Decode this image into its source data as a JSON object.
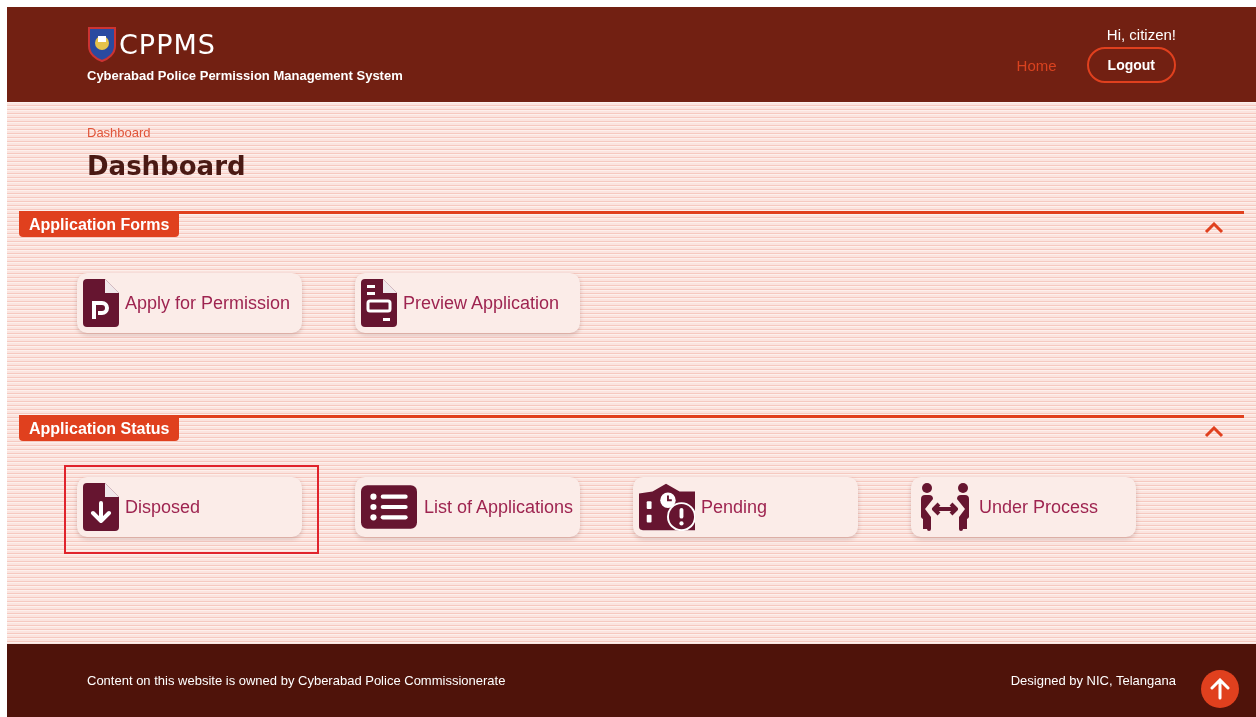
{
  "header": {
    "logo_text": "CPPMS",
    "subtitle": "Cyberabad Police Permission Management System",
    "greeting": "Hi, citizen!",
    "nav": [
      {
        "label": "Home",
        "kind": "link"
      },
      {
        "label": "Logout",
        "kind": "button"
      }
    ]
  },
  "breadcrumb": "Dashboard",
  "page_title": "Dashboard",
  "sections": [
    {
      "title": "Application Forms",
      "expanded": true,
      "tiles": [
        {
          "label": "Apply for Permission",
          "kind": "permission",
          "highlighted": false
        },
        {
          "label": "Preview Application",
          "kind": "preview",
          "highlighted": false
        }
      ]
    },
    {
      "title": "Application Status",
      "expanded": true,
      "tiles": [
        {
          "label": "Disposed",
          "kind": "disposed",
          "highlighted": true
        },
        {
          "label": "List of Applications",
          "kind": "list",
          "highlighted": false
        },
        {
          "label": "Pending",
          "kind": "pending",
          "highlighted": false
        },
        {
          "label": "Under Process",
          "kind": "process",
          "highlighted": false
        }
      ]
    }
  ],
  "footer": {
    "left": "Content on this website is owned by Cyberabad Police Commissionerate",
    "right": "Designed by NIC, Telangana"
  }
}
